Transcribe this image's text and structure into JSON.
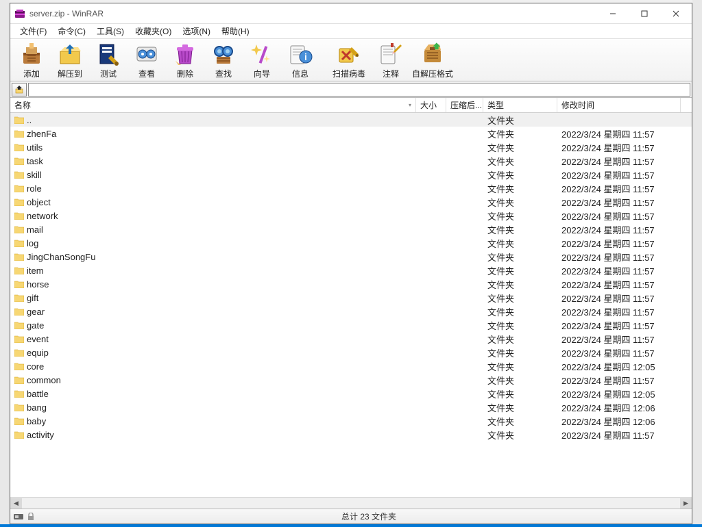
{
  "title": "server.zip - WinRAR",
  "menu": [
    "文件(F)",
    "命令(C)",
    "工具(S)",
    "收藏夹(O)",
    "选项(N)",
    "帮助(H)"
  ],
  "toolbar": [
    {
      "label": "添加",
      "icon": "add"
    },
    {
      "label": "解压到",
      "icon": "extract"
    },
    {
      "label": "测试",
      "icon": "test"
    },
    {
      "label": "查看",
      "icon": "view"
    },
    {
      "label": "删除",
      "icon": "delete"
    },
    {
      "label": "查找",
      "icon": "find"
    },
    {
      "label": "向导",
      "icon": "wizard"
    },
    {
      "label": "信息",
      "icon": "info"
    },
    {
      "label": "扫描病毒",
      "icon": "virus",
      "wide": true
    },
    {
      "label": "注释",
      "icon": "comment"
    },
    {
      "label": "自解压格式",
      "icon": "sfx",
      "wide": true
    }
  ],
  "columns": {
    "name": "名称",
    "size": "大小",
    "packed": "压缩后...",
    "type": "类型",
    "date": "修改时间"
  },
  "folder_type": "文件夹",
  "parent_name": "..",
  "rows": [
    {
      "name": "zhenFa",
      "date": "2022/3/24 星期四 11:57"
    },
    {
      "name": "utils",
      "date": "2022/3/24 星期四 11:57"
    },
    {
      "name": "task",
      "date": "2022/3/24 星期四 11:57"
    },
    {
      "name": "skill",
      "date": "2022/3/24 星期四 11:57"
    },
    {
      "name": "role",
      "date": "2022/3/24 星期四 11:57"
    },
    {
      "name": "object",
      "date": "2022/3/24 星期四 11:57"
    },
    {
      "name": "network",
      "date": "2022/3/24 星期四 11:57"
    },
    {
      "name": "mail",
      "date": "2022/3/24 星期四 11:57"
    },
    {
      "name": "log",
      "date": "2022/3/24 星期四 11:57"
    },
    {
      "name": "JingChanSongFu",
      "date": "2022/3/24 星期四 11:57"
    },
    {
      "name": "item",
      "date": "2022/3/24 星期四 11:57"
    },
    {
      "name": "horse",
      "date": "2022/3/24 星期四 11:57"
    },
    {
      "name": "gift",
      "date": "2022/3/24 星期四 11:57"
    },
    {
      "name": "gear",
      "date": "2022/3/24 星期四 11:57"
    },
    {
      "name": "gate",
      "date": "2022/3/24 星期四 11:57"
    },
    {
      "name": "event",
      "date": "2022/3/24 星期四 11:57"
    },
    {
      "name": "equip",
      "date": "2022/3/24 星期四 11:57"
    },
    {
      "name": "core",
      "date": "2022/3/24 星期四 12:05"
    },
    {
      "name": "common",
      "date": "2022/3/24 星期四 11:57"
    },
    {
      "name": "battle",
      "date": "2022/3/24 星期四 12:05"
    },
    {
      "name": "bang",
      "date": "2022/3/24 星期四 12:06"
    },
    {
      "name": "baby",
      "date": "2022/3/24 星期四 12:06"
    },
    {
      "name": "activity",
      "date": "2022/3/24 星期四 11:57"
    }
  ],
  "status": "总计 23 文件夹"
}
